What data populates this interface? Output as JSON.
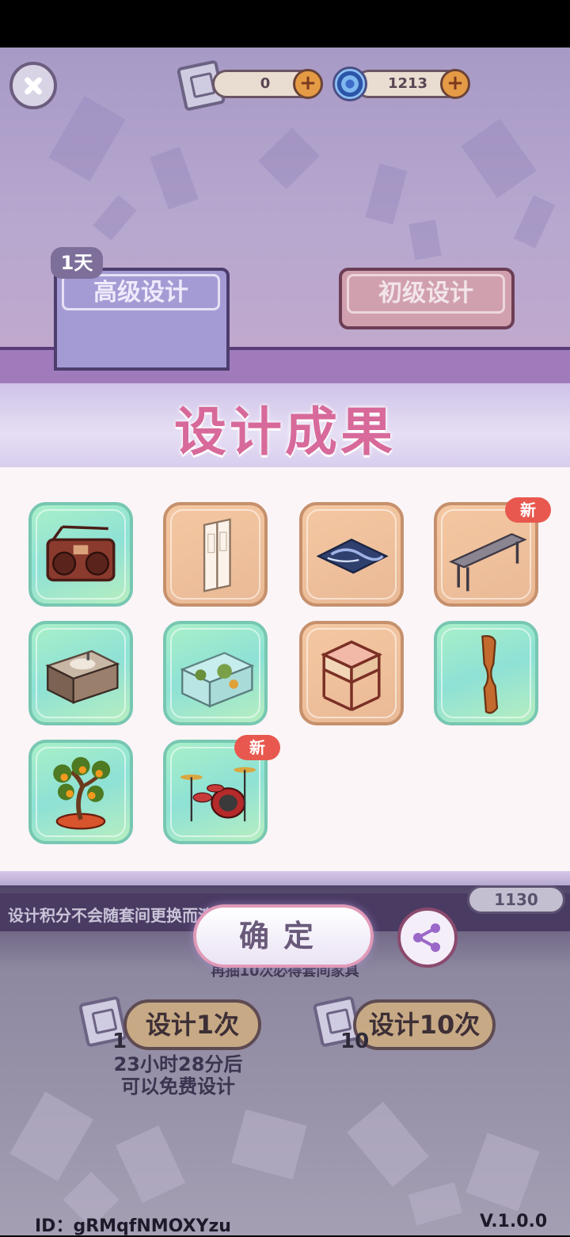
{
  "topbar": {
    "scroll_count": "0",
    "gem_count": "1213",
    "plus_label": "+"
  },
  "tabs": {
    "advanced_label": "高级设计",
    "advanced_badge": "1天",
    "basic_label": "初级设计"
  },
  "results": {
    "title": "设计成果",
    "new_badge": "新",
    "items": [
      {
        "name": "boombox-radio",
        "bg": "green",
        "is_new": false
      },
      {
        "name": "white-wardrobe",
        "bg": "orange",
        "is_new": false
      },
      {
        "name": "marble-rug",
        "bg": "orange",
        "is_new": false
      },
      {
        "name": "gray-bench",
        "bg": "orange",
        "is_new": true
      },
      {
        "name": "bathroom-sink-cabinet",
        "bg": "green",
        "is_new": false
      },
      {
        "name": "aquarium-tank",
        "bg": "green",
        "is_new": false
      },
      {
        "name": "cube-side-table",
        "bg": "orange",
        "is_new": false
      },
      {
        "name": "wooden-wall-shelf",
        "bg": "green",
        "is_new": false
      },
      {
        "name": "kumquat-bonsai",
        "bg": "green",
        "is_new": false
      },
      {
        "name": "drum-kit",
        "bg": "green",
        "is_new": true
      }
    ]
  },
  "buttons": {
    "confirm_label": "确定",
    "design_once_label": "设计1次",
    "design_once_cost": "1",
    "design_ten_label": "设计10次",
    "design_ten_cost": "10"
  },
  "behind": {
    "notice": "设计积分不会随套间更换而清",
    "score": "1130",
    "guarantee_hint": "再抽10次必得套间家具",
    "free_timer_line1": "23小时28分后",
    "free_timer_line2": "可以免费设计"
  },
  "footer": {
    "player_id": "ID：gRMqfNMOXYzu",
    "version": "V.1.0.0"
  },
  "colors": {
    "title_pink": "#d76a9a",
    "new_badge_red": "#e8584e",
    "green_tile": "#a9f0c8",
    "orange_tile": "#f4c8a2"
  }
}
